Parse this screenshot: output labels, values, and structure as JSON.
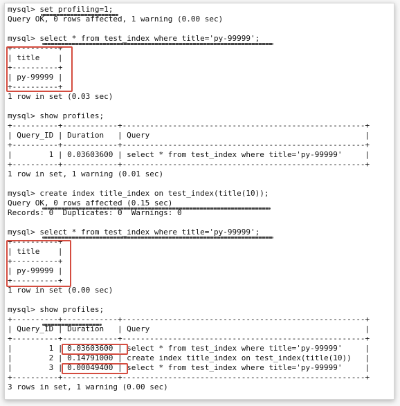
{
  "terminal": {
    "lines": [
      "mysql> set profiling=1;",
      "Query OK, 0 rows affected, 1 warning (0.00 sec)",
      "",
      "mysql> select * from test_index where title='py-99999';",
      "+----------+",
      "| title    |",
      "+----------+",
      "| py-99999 |",
      "+----------+",
      "1 row in set (0.03 sec)",
      "",
      "mysql> show profiles;",
      "+----------+------------+-----------------------------------------------------+",
      "| Query_ID | Duration   | Query                                               |",
      "+----------+------------+-----------------------------------------------------+",
      "|        1 | 0.03603600 | select * from test_index where title='py-99999'     |",
      "+----------+------------+-----------------------------------------------------+",
      "1 row in set, 1 warning (0.01 sec)",
      "",
      "mysql> create index title_index on test_index(title(10));",
      "Query OK, 0 rows affected (0.15 sec)",
      "Records: 0  Duplicates: 0  Warnings: 0",
      "",
      "mysql> select * from test_index where title='py-99999';",
      "+----------+",
      "| title    |",
      "+----------+",
      "| py-99999 |",
      "+----------+",
      "1 row in set (0.00 sec)",
      "",
      "mysql> show profiles;",
      "+----------+------------+-----------------------------------------------------+",
      "| Query_ID | Duration   | Query                                               |",
      "+----------+------------+-----------------------------------------------------+",
      "|        1 | 0.03603600 | select * from test_index where title='py-99999'     |",
      "|        2 | 0.14791000 | create index title_index on test_index(title(10))   |",
      "|        3 | 0.00049400 | select * from test_index where title='py-99999'     |",
      "+----------+------------+-----------------------------------------------------+",
      "3 rows in set, 1 warning (0.00 sec)"
    ]
  },
  "colors": {
    "highlight": "#d44c3f",
    "text": "#111111",
    "background": "#ffffff"
  }
}
